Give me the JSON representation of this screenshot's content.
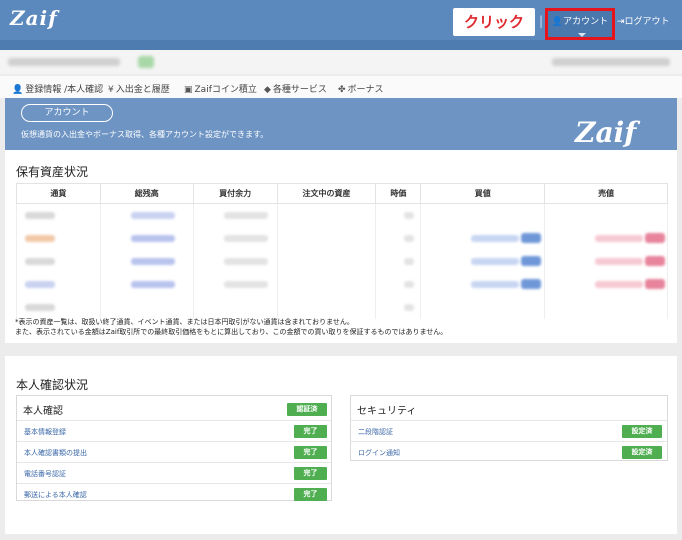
{
  "header": {
    "logo": "Zaif",
    "annotation": "クリック",
    "separator": "|",
    "account_label": "アカウント",
    "logout_label": "ログアウト",
    "accent_color": "#5b88bd",
    "highlight_color": "#e6141c"
  },
  "menu": [
    {
      "icon": "user-icon",
      "glyph": "👤",
      "label": "登録情報 /本人確認"
    },
    {
      "icon": "yen-icon",
      "glyph": "¥",
      "label": "入出金と履歴"
    },
    {
      "icon": "coin-icon",
      "glyph": "▣",
      "label": "Zaifコイン積立"
    },
    {
      "icon": "tag-icon",
      "glyph": "◆",
      "label": "各種サービス"
    },
    {
      "icon": "gift-icon",
      "glyph": "✤",
      "label": "ボーナス"
    }
  ],
  "banner": {
    "pill": "アカウント",
    "description": "仮想通貨の入出金やボーナス取得、各種アカウント設定ができます。",
    "logo": "Zaif"
  },
  "holdings": {
    "title": "保有資産状況",
    "columns": [
      "通貨",
      "総残高",
      "買付余力",
      "注文中の資産",
      "時価",
      "買値",
      "売値"
    ],
    "note_line1": "*表示の資産一覧は、取扱い終了通貨、イベント通貨、または日本円取引がない通貨は含まれておりません。",
    "note_line2": "また、表示されている金額はZaif取引所での最終取引価格をもとに算出しており、この金額での買い取りを保証するものではありません。"
  },
  "kyc": {
    "title": "本人確認状況",
    "identity": {
      "heading": "本人確認",
      "status": "認証済",
      "items": [
        {
          "label": "基本情報登録",
          "status": "完了"
        },
        {
          "label": "本人確認書類の提出",
          "status": "完了"
        },
        {
          "label": "電話番号認証",
          "status": "完了"
        },
        {
          "label": "郵送による本人確認",
          "status": "完了"
        }
      ]
    },
    "security": {
      "heading": "セキュリティ",
      "items": [
        {
          "label": "二段階認証",
          "status": "設定済"
        },
        {
          "label": "ログイン通知",
          "status": "設定済"
        }
      ]
    },
    "badge_color": "#4fae50"
  }
}
